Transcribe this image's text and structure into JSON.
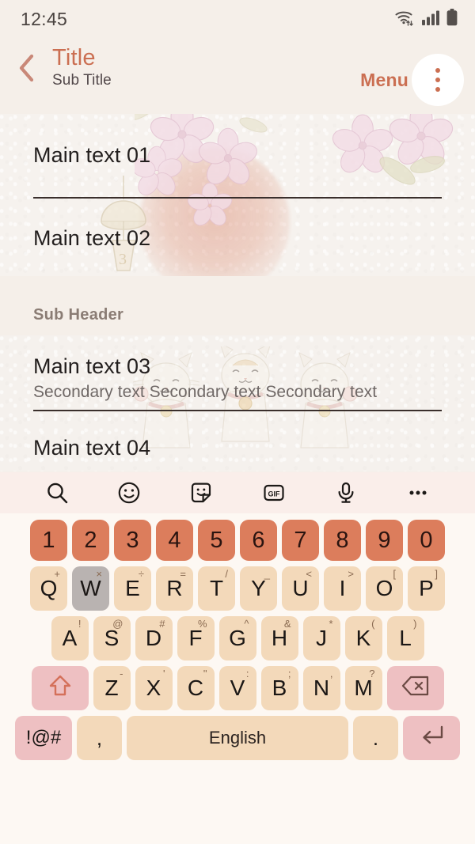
{
  "status_bar": {
    "time": "12:45",
    "icons": [
      "wifi-icon",
      "signal-icon",
      "battery-icon"
    ]
  },
  "app_bar": {
    "back_icon": "chevron-left-icon",
    "title": "Title",
    "subtitle": "Sub Title",
    "menu_label": "Menu",
    "overflow_icon": "more-vertical-icon",
    "title_color": "#cb6f52",
    "menu_color": "#cb6f52"
  },
  "content": {
    "items": [
      {
        "main": "Main text 01",
        "secondary": ""
      },
      {
        "main": "Main text 02",
        "secondary": ""
      }
    ],
    "sub_header": "Sub Header",
    "items2": [
      {
        "main": "Main text 03",
        "secondary": "Secondary text Secondary text Secondary text"
      },
      {
        "main": "Main text 04",
        "secondary": ""
      }
    ]
  },
  "keyboard": {
    "toolbar": [
      {
        "name": "search-icon",
        "label": "search"
      },
      {
        "name": "emoji-icon",
        "label": "emoji"
      },
      {
        "name": "sticker-icon",
        "label": "sticker"
      },
      {
        "name": "gif-icon",
        "label": "GIF"
      },
      {
        "name": "microphone-icon",
        "label": "voice"
      },
      {
        "name": "more-horizontal-icon",
        "label": "more"
      }
    ],
    "gif_label": "GIF",
    "number_row": [
      "1",
      "2",
      "3",
      "4",
      "5",
      "6",
      "7",
      "8",
      "9",
      "0"
    ],
    "row1": [
      {
        "key": "Q",
        "sup": "+"
      },
      {
        "key": "W",
        "sup": "×",
        "pressed": true
      },
      {
        "key": "E",
        "sup": "÷"
      },
      {
        "key": "R",
        "sup": "="
      },
      {
        "key": "T",
        "sup": "/"
      },
      {
        "key": "Y",
        "sup": "_"
      },
      {
        "key": "U",
        "sup": "<"
      },
      {
        "key": "I",
        "sup": ">"
      },
      {
        "key": "O",
        "sup": "["
      },
      {
        "key": "P",
        "sup": "]"
      }
    ],
    "row2": [
      {
        "key": "A",
        "sup": "!"
      },
      {
        "key": "S",
        "sup": "@"
      },
      {
        "key": "D",
        "sup": "#"
      },
      {
        "key": "F",
        "sup": "%"
      },
      {
        "key": "G",
        "sup": "^"
      },
      {
        "key": "H",
        "sup": "&"
      },
      {
        "key": "J",
        "sup": "*"
      },
      {
        "key": "K",
        "sup": "("
      },
      {
        "key": "L",
        "sup": ")"
      }
    ],
    "row3": [
      {
        "key": "Z",
        "sup": "-"
      },
      {
        "key": "X",
        "sup": "'"
      },
      {
        "key": "C",
        "sup": "\""
      },
      {
        "key": "V",
        "sup": ":"
      },
      {
        "key": "B",
        "sup": ";"
      },
      {
        "key": "N",
        "sup": ","
      },
      {
        "key": "M",
        "sup": "?"
      }
    ],
    "shift_icon": "shift-arrow-icon",
    "backspace_icon": "backspace-icon",
    "symbols_label": "!@#",
    "comma_label": ",",
    "space_label": "English",
    "period_label": ".",
    "enter_icon": "enter-arrow-icon",
    "colors": {
      "number_key": "#dc7d5c",
      "letter_key": "#f3d9ba",
      "function_key": "#eec0c2",
      "pressed_key": "#b9b3b1",
      "keyboard_bg": "#fdf8f3",
      "toolbar_bg": "#faeeea"
    }
  }
}
